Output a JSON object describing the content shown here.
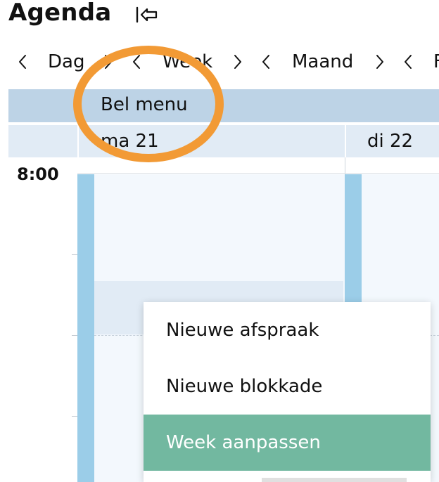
{
  "header": {
    "title": "Agenda",
    "exit_icon": "exit-left-icon"
  },
  "nav": {
    "items": [
      {
        "label": "Dag"
      },
      {
        "label": "Week"
      },
      {
        "label": "Maand"
      },
      {
        "label": "F"
      }
    ],
    "prev_icon": "chevron-left-icon",
    "next_icon": "chevron-right-icon"
  },
  "bel_menu": {
    "label": "Bel menu"
  },
  "days": [
    {
      "label": "ma 21"
    },
    {
      "label": "di 22"
    }
  ],
  "times": [
    "8:00"
  ],
  "context_menu": {
    "items": [
      {
        "label": "Nieuwe afspraak"
      },
      {
        "label": "Nieuwe blokkade"
      },
      {
        "label": "Week aanpassen",
        "active": true
      }
    ]
  },
  "colors": {
    "bar_blue": "#bdd3e6",
    "event_blue": "#9bcde8",
    "active_green": "#72b8a0",
    "annotation_orange": "#f29a35"
  }
}
